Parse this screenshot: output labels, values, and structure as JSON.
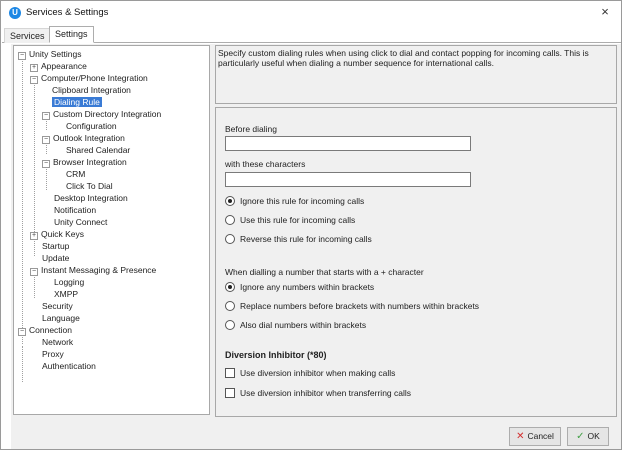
{
  "window": {
    "title": "Services & Settings",
    "close_glyph": "×"
  },
  "tabs": [
    {
      "label": "Services",
      "active": false
    },
    {
      "label": "Settings",
      "active": true
    }
  ],
  "tree": {
    "items": [
      {
        "label": "Unity Settings",
        "expander": "−"
      },
      {
        "label": "Appearance",
        "expander": "+"
      },
      {
        "label": "Computer/Phone Integration",
        "expander": "−"
      },
      {
        "label": "Clipboard Integration"
      },
      {
        "label": "Dialing Rule",
        "selected": true
      },
      {
        "label": "Custom Directory Integration",
        "expander": "−"
      },
      {
        "label": "Configuration"
      },
      {
        "label": "Outlook Integration",
        "expander": "−"
      },
      {
        "label": "Shared Calendar"
      },
      {
        "label": "Browser Integration",
        "expander": "−"
      },
      {
        "label": "CRM"
      },
      {
        "label": "Click To Dial"
      },
      {
        "label": "Desktop Integration"
      },
      {
        "label": "Notification"
      },
      {
        "label": "Unity Connect"
      },
      {
        "label": "Quick Keys",
        "expander": "+"
      },
      {
        "label": "Startup"
      },
      {
        "label": "Update"
      },
      {
        "label": "Instant Messaging & Presence",
        "expander": "−"
      },
      {
        "label": "Logging"
      },
      {
        "label": "XMPP"
      },
      {
        "label": "Security"
      },
      {
        "label": "Language"
      },
      {
        "label": "Connection",
        "expander": "−"
      },
      {
        "label": "Network"
      },
      {
        "label": "Proxy"
      },
      {
        "label": "Authentication"
      }
    ]
  },
  "description": "Specify custom dialing rules when using click to dial and contact popping for incoming calls. This is particularly useful when dialing a number sequence for international calls.",
  "form": {
    "before_dialing_label": "Before dialing",
    "before_dialing_value": "",
    "with_chars_label": "with these characters",
    "with_chars_value": "",
    "incoming_options": [
      {
        "label": "Ignore this rule for incoming calls",
        "checked": true
      },
      {
        "label": "Use this rule for incoming calls",
        "checked": false
      },
      {
        "label": "Reverse this rule for incoming calls",
        "checked": false
      }
    ],
    "plus_heading": "When dialling a number that starts with a + character",
    "plus_options": [
      {
        "label": "Ignore any numbers within brackets",
        "checked": true
      },
      {
        "label": "Replace numbers before brackets with numbers within brackets",
        "checked": false
      },
      {
        "label": "Also dial numbers within brackets",
        "checked": false
      }
    ],
    "diversion_title": "Diversion Inhibitor (*80)",
    "diversion_options": [
      {
        "label": "Use diversion inhibitor when making calls",
        "checked": false
      },
      {
        "label": "Use diversion inhibitor when transferring calls",
        "checked": false
      }
    ]
  },
  "buttons": {
    "cancel_icon": "✕",
    "cancel_label": "Cancel",
    "ok_icon": "✓",
    "ok_label": "OK"
  },
  "colors": {
    "selection": "#3a7bd5",
    "title_icon": "#1e88e5",
    "cancel_icon": "#d32f2f",
    "ok_icon": "#43a047"
  }
}
